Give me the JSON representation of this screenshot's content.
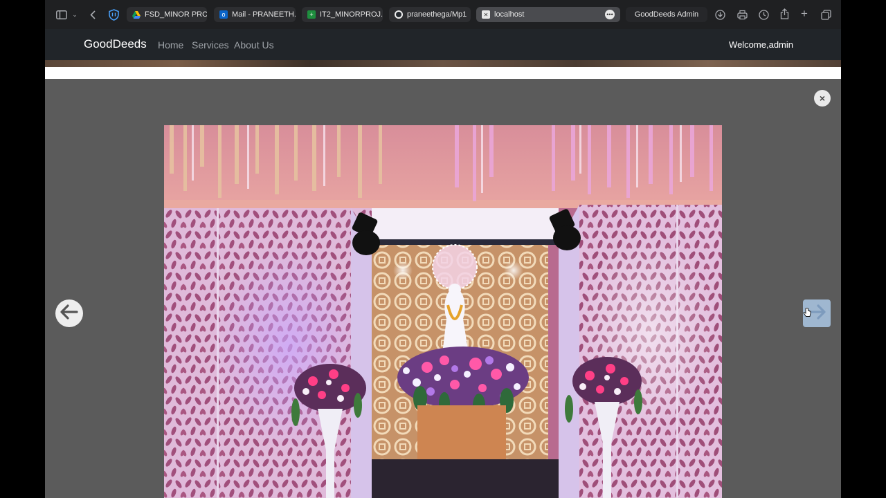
{
  "browser": {
    "tabs": [
      {
        "label": "FSD_MINOR PRO...",
        "icon": "google-drive-icon",
        "active": false
      },
      {
        "label": "Mail - PRANEETH...",
        "icon": "outlook-icon",
        "active": false
      },
      {
        "label": "IT2_MINORPROJ...",
        "icon": "google-sheets-icon",
        "active": false
      },
      {
        "label": "praneethega/Mp1",
        "icon": "github-icon",
        "active": false
      },
      {
        "label": "localhost",
        "icon": "page-icon",
        "active": true
      },
      {
        "label": "GoodDeeds Admin",
        "icon": "page-icon",
        "active": false
      }
    ]
  },
  "navbar": {
    "brand": "GoodDeeds",
    "links": [
      "Home",
      "Services",
      "About Us"
    ],
    "welcome": "Welcome,admin"
  },
  "lightbox": {
    "close_label": "×",
    "image_alt": "Decorated shrine with white statue, floral arrangements and lattice panels"
  },
  "colors": {
    "navbar_bg": "#212529",
    "overlay_bg": "#5b5b5b",
    "tabbar_bg": "#1f2022"
  }
}
